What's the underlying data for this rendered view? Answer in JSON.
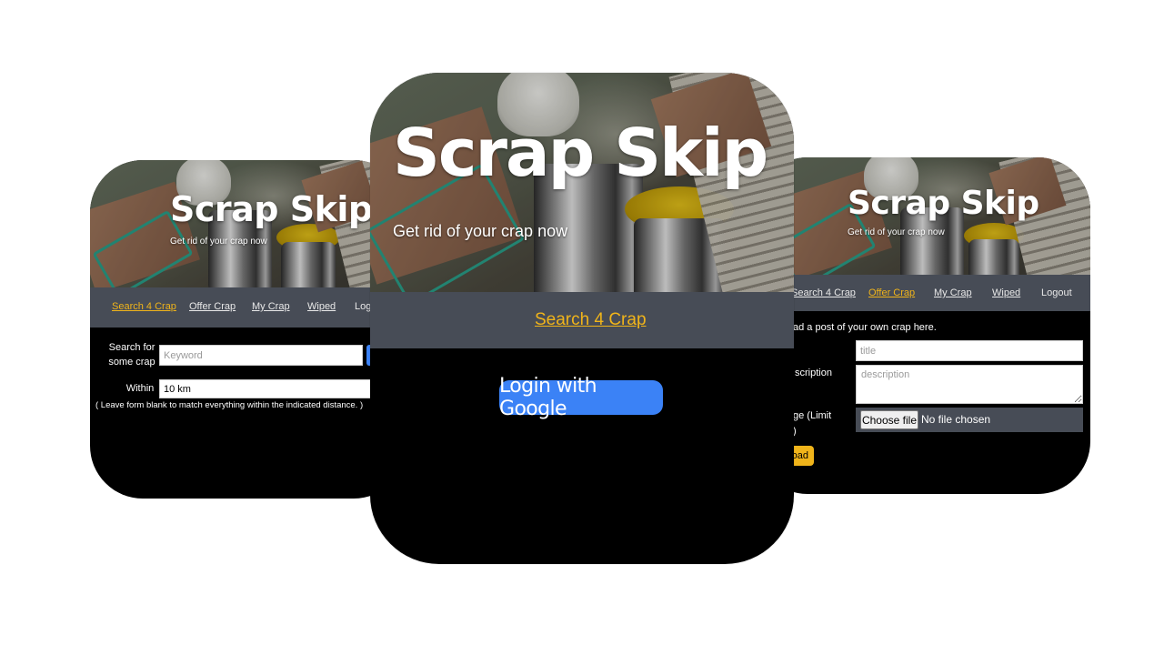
{
  "app": {
    "title": "Scrap Skip",
    "tagline": "Get rid of your crap now"
  },
  "nav": {
    "search": "Search 4 Crap",
    "offer": "Offer Crap",
    "mine": "My Crap",
    "wiped": "Wiped",
    "logout": "Logout",
    "logout_partial": "Logo"
  },
  "left_screen": {
    "search_label": "Search for some crap",
    "keyword_placeholder": "Keyword",
    "within_label": "Within",
    "within_value": "10 km",
    "hint": "( Leave form blank to match everything within the indicated distance. )"
  },
  "center_screen": {
    "nav_link": "Search 4 Crap",
    "login_button": "Login with Google"
  },
  "right_screen": {
    "intro": "ad a post of your own crap here.",
    "description_label": "scription",
    "image_label_line1": "ge (Limit",
    "image_label_line2": ")",
    "title_placeholder": "title",
    "description_placeholder": "description",
    "choose_file": "Choose file",
    "no_file": "No file chosen",
    "upload_button": "oad"
  },
  "colors": {
    "accent_yellow": "#f0b41a",
    "nav_bg": "#474c56",
    "button_blue": "#3b82f6",
    "card_bg": "#000000"
  }
}
